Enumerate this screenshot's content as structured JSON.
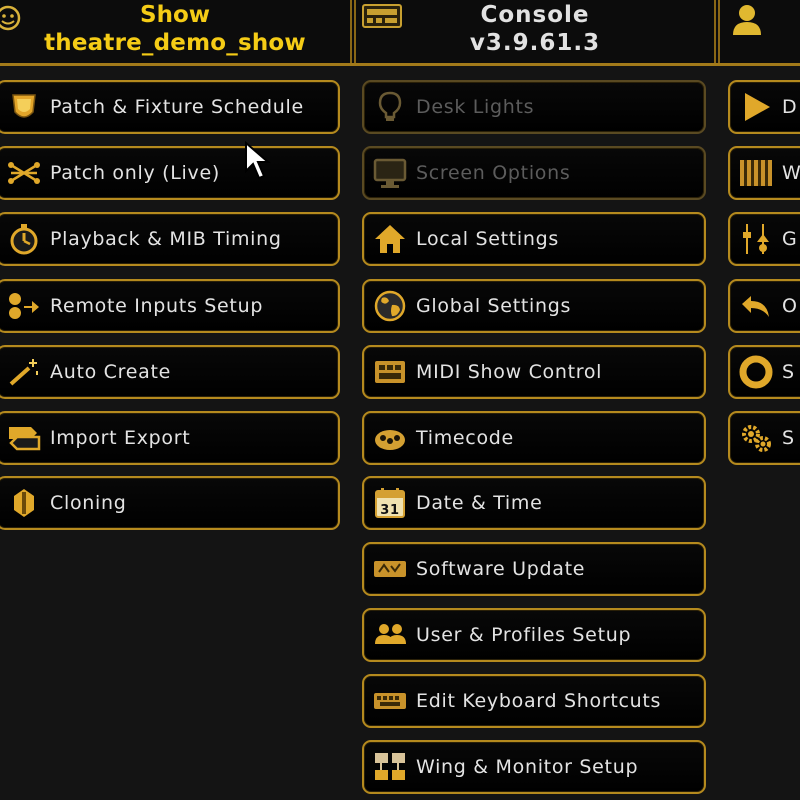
{
  "header": {
    "show_label": "Show",
    "show_name": "theatre_demo_show",
    "console_label": "Console",
    "console_version": "v3.9.61.3",
    "user_label": ""
  },
  "colors": {
    "accent": "#b58a1e",
    "show_text": "#f5cc16",
    "button_text": "#e3e3e3",
    "disabled_text": "#5c5c5c",
    "background": "#141414"
  },
  "menu": {
    "col1": [
      {
        "label": "Patch & Fixture Schedule",
        "icon": "shield-fixture-icon"
      },
      {
        "label": "Patch only (Live)",
        "icon": "patch-lines-icon"
      },
      {
        "label": "Playback & MIB Timing",
        "icon": "stopwatch-icon"
      },
      {
        "label": "Remote Inputs Setup",
        "icon": "remote-inputs-icon"
      },
      {
        "label": "Auto Create",
        "icon": "magic-wand-icon"
      },
      {
        "label": "Import Export",
        "icon": "import-export-icon"
      },
      {
        "label": "Cloning",
        "icon": "clone-icon"
      }
    ],
    "col2": [
      {
        "label": "Desk Lights",
        "icon": "light-bulb-icon",
        "disabled": true
      },
      {
        "label": "Screen Options",
        "icon": "monitor-icon",
        "disabled": true
      },
      {
        "label": "Local Settings",
        "icon": "home-icon"
      },
      {
        "label": "Global Settings",
        "icon": "globe-icon"
      },
      {
        "label": "MIDI Show Control",
        "icon": "midi-icon"
      },
      {
        "label": "Timecode",
        "icon": "timecode-icon"
      },
      {
        "label": "Date & Time",
        "icon": "calendar-icon",
        "calendar_day": "31"
      },
      {
        "label": "Software Update",
        "icon": "software-update-icon"
      },
      {
        "label": "User & Profiles Setup",
        "icon": "users-icon"
      },
      {
        "label": "Edit Keyboard Shortcuts",
        "icon": "keyboard-icon"
      },
      {
        "label": "Wing & Monitor Setup",
        "icon": "wing-monitor-icon"
      }
    ],
    "col3": [
      {
        "label": "D",
        "icon": "play-icon"
      },
      {
        "label": "W",
        "icon": "wings-icon"
      },
      {
        "label": "G",
        "icon": "faders-icon"
      },
      {
        "label": "O",
        "icon": "undo-arrow-icon"
      },
      {
        "label": "S",
        "icon": "ring-icon"
      },
      {
        "label": "S",
        "icon": "gears-icon"
      }
    ]
  }
}
